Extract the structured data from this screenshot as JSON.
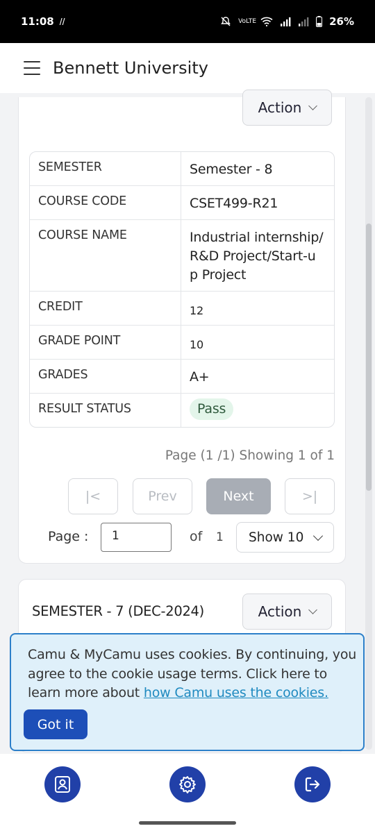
{
  "status_bar": {
    "time": "11:08",
    "time_extra": "//",
    "battery": "26%",
    "network": "VoLTE"
  },
  "header": {
    "title": "Bennett University"
  },
  "course_card": {
    "action_label": "Action",
    "details": [
      {
        "label": "SEMESTER",
        "value": "Semester - 8"
      },
      {
        "label": "COURSE CODE",
        "value": "CSET499-R21"
      },
      {
        "label": "COURSE NAME",
        "value_lines": [
          "Industrial internship/",
          "R&D Project/Start-u",
          "p Project"
        ]
      },
      {
        "label": "CREDIT",
        "value": "12"
      },
      {
        "label": "GRADE POINT",
        "value": "10"
      },
      {
        "label": "GRADES",
        "value": "A+"
      },
      {
        "label": "RESULT STATUS",
        "value": "Pass"
      }
    ],
    "pagination": {
      "info": "Page (1 /1)  Showing 1 of 1",
      "first_label": "|<",
      "prev_label": "Prev",
      "next_label": "Next",
      "last_label": ">|",
      "page_label": "Page :",
      "page_value": "1",
      "of_label": "of",
      "total_pages": "1",
      "show_label": "Show 10"
    }
  },
  "next_semester": {
    "title": "SEMESTER - 7 (DEC-2024)",
    "action_label": "Action"
  },
  "cookie_banner": {
    "text": "Camu & MyCamu uses cookies. By continuing, you agree to the cookie usage terms. Click here to learn more about ",
    "link_text": "how Camu uses the cookies.",
    "button_label": "Got it"
  },
  "bottom_nav": {
    "icons": [
      "profile-icon",
      "settings-icon",
      "logout-icon"
    ],
    "accent_color": "#2140a8"
  }
}
